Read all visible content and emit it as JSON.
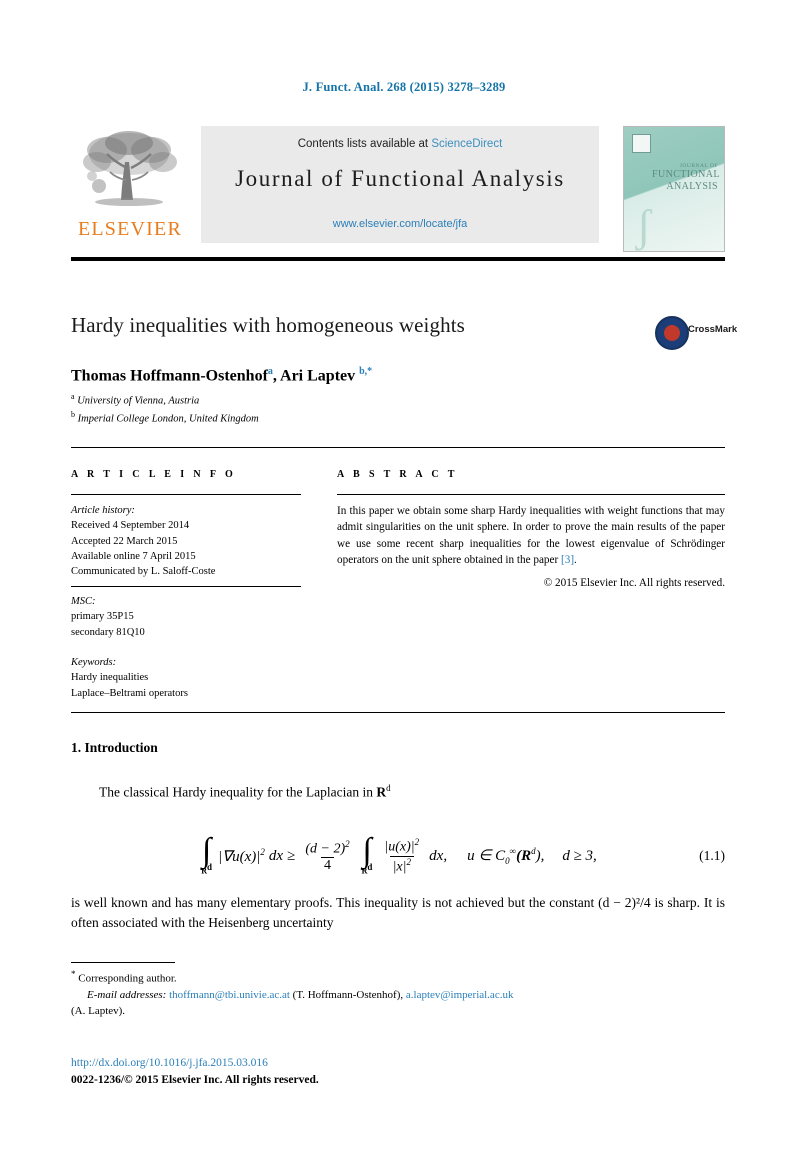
{
  "running_head": "J. Funct. Anal. 268 (2015) 3278–3289",
  "masthead": {
    "publisher_name": "ELSEVIER",
    "contents_prefix": "Contents lists available at ",
    "contents_link": "ScienceDirect",
    "journal_name": "Journal of Functional Analysis",
    "journal_url": "www.elsevier.com/locate/jfa",
    "cover": {
      "line1": "JOURNAL OF",
      "line2": "FUNCTIONAL",
      "line3": "ANALYSIS"
    }
  },
  "article": {
    "title": "Hardy inequalities with homogeneous weights",
    "crossmark_label": "CrossMark",
    "authors_part1": "Thomas Hoffmann-Ostenhof",
    "author1_mark": "a",
    "authors_sep": ", Ari Laptev ",
    "author2_mark": "b,*",
    "affiliations": [
      {
        "mark": "a",
        "text": "University of Vienna, Austria"
      },
      {
        "mark": "b",
        "text": "Imperial College London, United Kingdom"
      }
    ]
  },
  "info": {
    "heading": "A R T I C L E    I N F O",
    "history_label": "Article history:",
    "history": [
      "Received 4 September 2014",
      "Accepted 22 March 2015",
      "Available online 7 April 2015",
      "Communicated by L. Saloff-Coste"
    ],
    "msc_label": "MSC:",
    "msc": [
      "primary 35P15",
      "secondary 81Q10"
    ],
    "keywords_label": "Keywords:",
    "keywords": [
      "Hardy inequalities",
      "Laplace–Beltrami operators"
    ]
  },
  "abstract": {
    "heading": "A B S T R A C T",
    "text_part1": "In this paper we obtain some sharp Hardy inequalities with weight functions that may admit singularities on the unit sphere. In order to prove the main results of the paper we use some recent sharp inequalities for the lowest eigenvalue of Schrödinger operators on the unit sphere obtained in the paper ",
    "reference": "[3]",
    "text_part2": ".",
    "copyright": "© 2015 Elsevier Inc. All rights reserved."
  },
  "body": {
    "section_heading": "1. Introduction",
    "paragraph1_part1": "The classical Hardy inequality for the Laplacian in ",
    "paragraph1_math": "R",
    "paragraph1_math_sup": "d",
    "paragraph2": "is well known and has many elementary proofs. This inequality is not achieved but the constant (d − 2)²/4 is sharp. It is often associated with the Heisenberg uncertainty"
  },
  "equation": {
    "number": "(1.1)",
    "int1_limit": "R",
    "int1_limit_sup": "d",
    "lhs_integrand": "|∇u(x)|",
    "lhs_integrand_sup": "2",
    "lhs_dx": "dx",
    "relation": "≥",
    "frac_num": "(d − 2)",
    "frac_num_sup": "2",
    "frac_den": "4",
    "int2_limit": "R",
    "int2_limit_sup": "d",
    "rhs_num": "|u(x)|",
    "rhs_num_sup": "2",
    "rhs_den": "|x|",
    "rhs_den_sup": "2",
    "rhs_dx": "dx,",
    "condition1_u": "u ∈ C",
    "condition1_sub": "0",
    "condition1_sup": "∞",
    "condition1_space": "(R",
    "condition1_space_sup": "d",
    "condition1_close": "),",
    "condition2": "d ≥ 3,"
  },
  "footnotes": {
    "corresponding_mark": "*",
    "corresponding": "Corresponding author.",
    "email_label": "E-mail addresses:",
    "email1": "thoffmann@tbi.univie.ac.at",
    "email1_owner": "(T. Hoffmann-Ostenhof),",
    "email2": "a.laptev@imperial.ac.uk",
    "email2_owner": "(A. Laptev)."
  },
  "footer": {
    "doi": "http://dx.doi.org/10.1016/j.jfa.2015.03.016",
    "issn": "0022-1236/© 2015 Elsevier Inc. All rights reserved."
  },
  "colors": {
    "link": "#2b7fb8",
    "running_head": "#1573a8",
    "elsevier_orange": "#e87d1e",
    "cover_teal": "#8fc6ba"
  }
}
